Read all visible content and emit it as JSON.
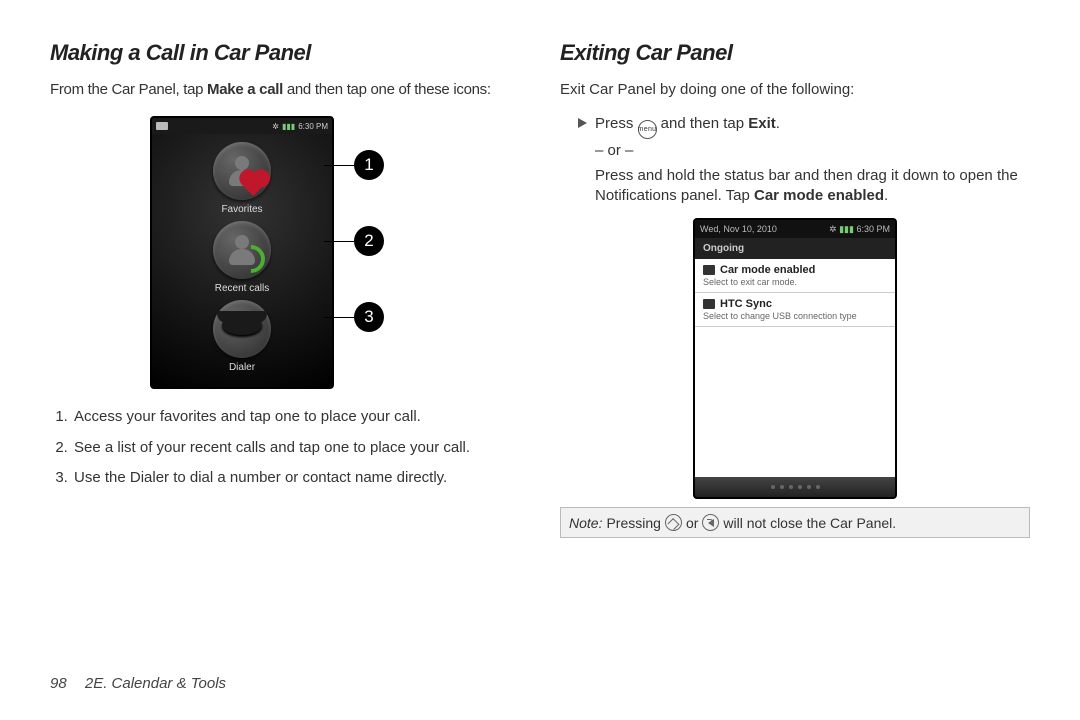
{
  "left": {
    "heading": "Making a Call in Car Panel",
    "intro_a": "From the Car Panel, tap ",
    "intro_b": "Make a call",
    "intro_c": " and then tap one of these icons:",
    "phone": {
      "time": "6:30 PM",
      "apps": {
        "favorites": "Favorites",
        "recent": "Recent calls",
        "dialer": "Dialer"
      }
    },
    "callouts": {
      "c1": "1",
      "c2": "2",
      "c3": "3"
    },
    "steps": {
      "s1": "Access your favorites and tap one to place your call.",
      "s2": "See a list of your recent calls and tap one to place your call.",
      "s3": "Use the Dialer to dial a number or contact name directly."
    }
  },
  "right": {
    "heading": "Exiting Car Panel",
    "intro": "Exit Car Panel by doing one of the following:",
    "opt1_a": "Press ",
    "opt1_menu": "menu",
    "opt1_b": " and then tap ",
    "opt1_c": "Exit",
    "opt1_d": ".",
    "or": "– or –",
    "opt2_a": "Press and hold the status bar and then drag it down to open the Notifications panel. Tap ",
    "opt2_b": "Car mode enabled",
    "opt2_c": ".",
    "phone": {
      "date": "Wed, Nov 10, 2010",
      "time": "6:30 PM",
      "ongoing": "Ongoing",
      "n1_title": "Car mode enabled",
      "n1_sub": "Select to exit car mode.",
      "n2_title": "HTC Sync",
      "n2_sub": "Select to change USB connection type"
    },
    "note_a": "Note:",
    "note_b": "Pressing",
    "note_c": "or",
    "note_d": "will not close the Car Panel."
  },
  "footer": {
    "page": "98",
    "section": "2E. Calendar & Tools"
  }
}
